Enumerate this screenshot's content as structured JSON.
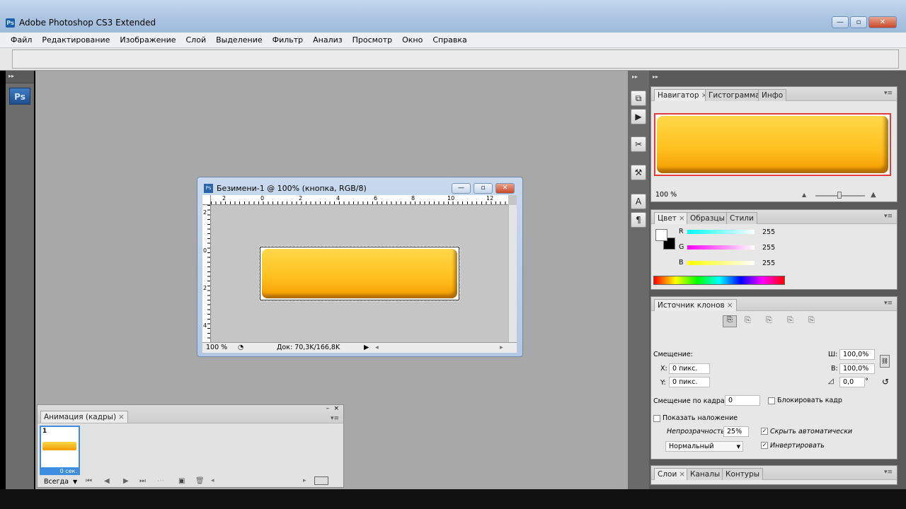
{
  "app": {
    "title": "Adobe Photoshop CS3 Extended",
    "icon": "Ps"
  },
  "window_buttons": {
    "minimize": "—",
    "restore": "▫",
    "close": "✕"
  },
  "menu": [
    "Файл",
    "Редактирование",
    "Изображение",
    "Слой",
    "Выделение",
    "Фильтр",
    "Анализ",
    "Просмотр",
    "Окно",
    "Справка"
  ],
  "toolbox": {
    "logo": "Ps",
    "grip": "▸▸"
  },
  "dock_icons": [
    "history-icon",
    "actions-icon",
    "tools-icon",
    "brushes-icon",
    "character-icon",
    "paragraph-icon"
  ],
  "dock_glyphs": [
    "⧉",
    "▶",
    "✂",
    "⚒",
    "A",
    "¶"
  ],
  "document": {
    "title": "Безимени-1 @ 100% (кнопка, RGB/8)",
    "icon": "Ps",
    "zoom": "100 %",
    "doc_info": "Док: 70,3K/166,8K",
    "ruler_h": [
      "2",
      "0",
      "2",
      "4",
      "6",
      "8",
      "10",
      "12"
    ],
    "ruler_v": [
      "2",
      "0",
      "2",
      "4"
    ]
  },
  "navigator_panel": {
    "tabs": [
      "Навигатор",
      "Гистограмма",
      "Инфо"
    ],
    "zoom": "100 %"
  },
  "color_panel": {
    "tabs": [
      "Цвет",
      "Образцы",
      "Стили"
    ],
    "r_label": "R",
    "g_label": "G",
    "b_label": "B",
    "r": "255",
    "g": "255",
    "b": "255"
  },
  "clone_panel": {
    "tabs": [
      "Источник клонов"
    ],
    "offset_label": "Смещение:",
    "x_label": "X:",
    "x_value": "0 пикс.",
    "y_label": "Y:",
    "y_value": "0 пикс.",
    "w_label": "Ш:",
    "w_value": "100,0%",
    "h_label": "В:",
    "h_value": "100,0%",
    "angle_value": "0,0",
    "angle_unit": "°",
    "frame_offset_label": "Смещение по кадрам:",
    "frame_offset_value": "0",
    "lock_frame_label": "Блокировать кадр",
    "show_overlay_label": "Показать наложение",
    "opacity_label": "Непрозрачность:",
    "opacity_value": "25%",
    "auto_hide_label": "Скрыть автоматически",
    "blend_mode": "Нормальный",
    "invert_label": "Инвертировать"
  },
  "layers_panel": {
    "tabs": [
      "Слои",
      "Каналы",
      "Контуры"
    ]
  },
  "animation_panel": {
    "tab": "Анимация (кадры)",
    "frame_number": "1",
    "frame_delay": "0 сек.",
    "loop": "Всегда"
  },
  "colors": {
    "accent": "#3d8de0",
    "button_yellow": "#ffc21f",
    "workspace": "#a8a8a8"
  }
}
